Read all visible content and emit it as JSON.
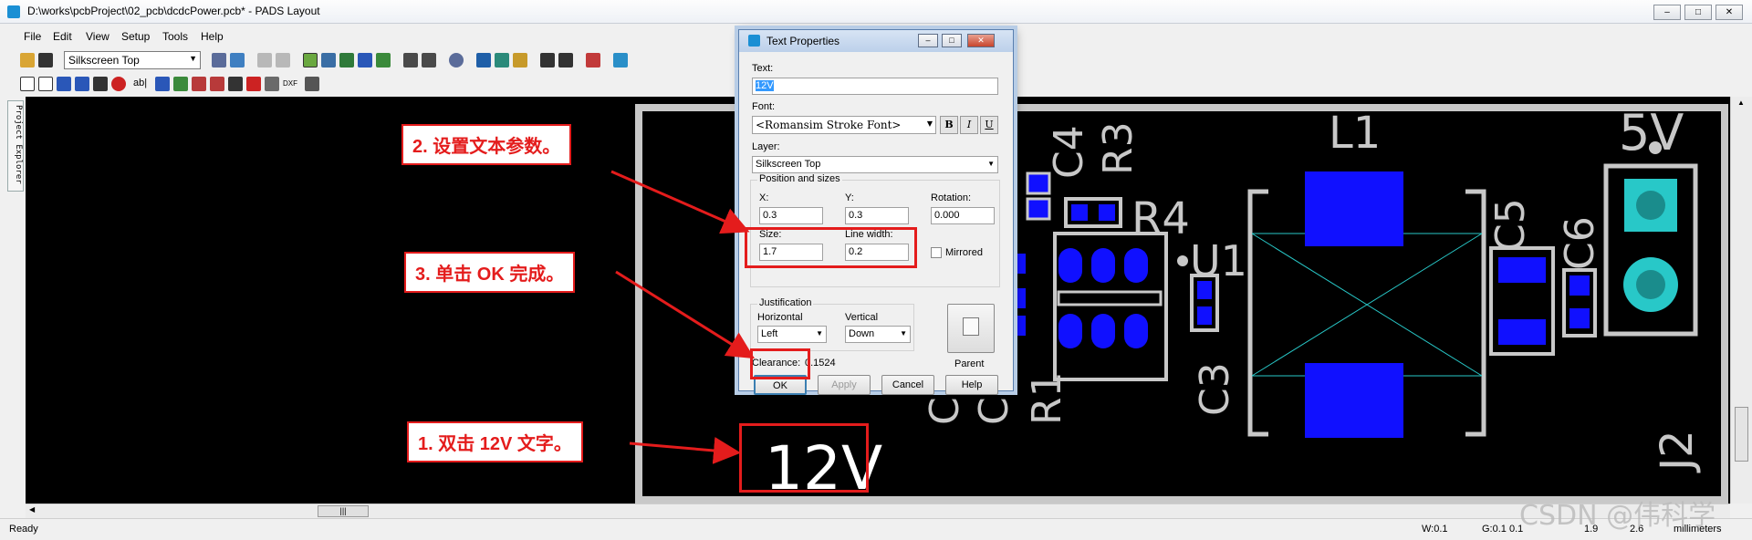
{
  "window": {
    "title": "D:\\works\\pcbProject\\02_pcb\\dcdcPower.pcb* - PADS Layout",
    "minimize": "–",
    "maximize": "□",
    "close": "✕"
  },
  "menu": [
    "File",
    "Edit",
    "View",
    "Setup",
    "Tools",
    "Help"
  ],
  "toolbar": {
    "layer_value": "Silkscreen Top",
    "icons_row1": [
      "open-icon",
      "save-icon",
      "layer-setup-icon",
      "redraw-icon",
      "zoom-prev-icon",
      "zoom-next-icon",
      "design-toolbar-icon",
      "drafting-toolbar-icon",
      "ecad-icon",
      "route-icon",
      "cluster-icon",
      "undo-icon",
      "redo-icon",
      "find-icon",
      "view-icon",
      "pan-icon",
      "sketch-icon",
      "properties-icon",
      "macro-icon",
      "verify-icon",
      "help-icon"
    ],
    "icons_row2": [
      "select-icon",
      "move-icon",
      "layer-icon",
      "trace-icon",
      "copy-icon",
      "delete-icon",
      "text-ab-icon",
      "net-icon",
      "bom-icon",
      "pin-icon",
      "ratsnest-icon",
      "dimension-icon",
      "gerber-icon",
      "import-icon",
      "dxf-icon",
      "list-icon"
    ],
    "text_icon": "ab|",
    "dxf_label": "DXF"
  },
  "left_panel": {
    "tab": "Project Explorer"
  },
  "board": {
    "labels": [
      "C4",
      "R3",
      "L1",
      "5V",
      "R4",
      "U1",
      "C5",
      "C6",
      "C3",
      "R1",
      "J2",
      "C",
      "C"
    ],
    "text_selected": "12V",
    "colors": {
      "outline": "#c8c8c8",
      "pad": "#1010ff",
      "connector_pad": "#28c8c8",
      "board": "#000000"
    }
  },
  "dialog": {
    "title": "Text Properties",
    "text_label": "Text:",
    "text_value": "12V",
    "font_label": "Font:",
    "font_value": "<Romansim Stroke Font>",
    "bold": "B",
    "italic": "I",
    "underline": "U",
    "layer_label": "Layer:",
    "layer_value": "Silkscreen Top",
    "position_group": "Position and sizes",
    "x_label": "X:",
    "x_value": "0.3",
    "y_label": "Y:",
    "y_value": "0.3",
    "rotation_label": "Rotation:",
    "rotation_value": "0.000",
    "size_label": "Size:",
    "size_value": "1.7",
    "linewidth_label": "Line width:",
    "linewidth_value": "0.2",
    "mirrored_label": "Mirrored",
    "justification_group": "Justification",
    "horizontal_label": "Horizontal",
    "horizontal_value": "Left",
    "vertical_label": "Vertical",
    "vertical_value": "Down",
    "parent_label": "Parent",
    "clearance_label": "Clearance:",
    "clearance_value": "0.1524",
    "ok": "OK",
    "apply": "Apply",
    "cancel": "Cancel",
    "help": "Help"
  },
  "callouts": {
    "step1": "1. 双击 12V 文字。",
    "step2": "2. 设置文本参数。",
    "step3": "3. 单击 OK 完成。"
  },
  "statusbar": {
    "ready": "Ready",
    "width": "W:0.1",
    "grid": "G:0.1 0.1",
    "x": "1.9",
    "y": "2.6",
    "units": "millimeters"
  },
  "watermark": "CSDN @伟科学"
}
